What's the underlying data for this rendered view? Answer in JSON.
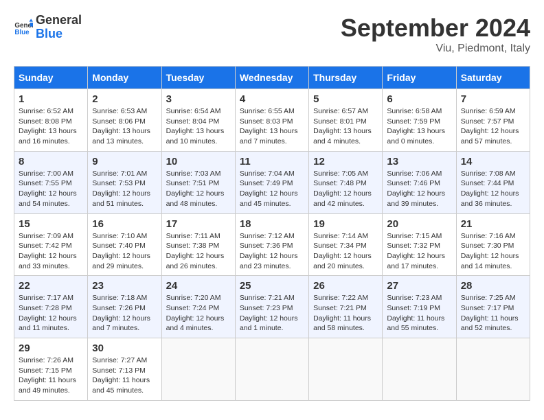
{
  "header": {
    "logo_line1": "General",
    "logo_line2": "Blue",
    "month": "September 2024",
    "location": "Viu, Piedmont, Italy"
  },
  "days_of_week": [
    "Sunday",
    "Monday",
    "Tuesday",
    "Wednesday",
    "Thursday",
    "Friday",
    "Saturday"
  ],
  "weeks": [
    [
      {
        "day": 1,
        "lines": [
          "Sunrise: 6:52 AM",
          "Sunset: 8:08 PM",
          "Daylight: 13 hours",
          "and 16 minutes."
        ]
      },
      {
        "day": 2,
        "lines": [
          "Sunrise: 6:53 AM",
          "Sunset: 8:06 PM",
          "Daylight: 13 hours",
          "and 13 minutes."
        ]
      },
      {
        "day": 3,
        "lines": [
          "Sunrise: 6:54 AM",
          "Sunset: 8:04 PM",
          "Daylight: 13 hours",
          "and 10 minutes."
        ]
      },
      {
        "day": 4,
        "lines": [
          "Sunrise: 6:55 AM",
          "Sunset: 8:03 PM",
          "Daylight: 13 hours",
          "and 7 minutes."
        ]
      },
      {
        "day": 5,
        "lines": [
          "Sunrise: 6:57 AM",
          "Sunset: 8:01 PM",
          "Daylight: 13 hours",
          "and 4 minutes."
        ]
      },
      {
        "day": 6,
        "lines": [
          "Sunrise: 6:58 AM",
          "Sunset: 7:59 PM",
          "Daylight: 13 hours",
          "and 0 minutes."
        ]
      },
      {
        "day": 7,
        "lines": [
          "Sunrise: 6:59 AM",
          "Sunset: 7:57 PM",
          "Daylight: 12 hours",
          "and 57 minutes."
        ]
      }
    ],
    [
      {
        "day": 8,
        "lines": [
          "Sunrise: 7:00 AM",
          "Sunset: 7:55 PM",
          "Daylight: 12 hours",
          "and 54 minutes."
        ]
      },
      {
        "day": 9,
        "lines": [
          "Sunrise: 7:01 AM",
          "Sunset: 7:53 PM",
          "Daylight: 12 hours",
          "and 51 minutes."
        ]
      },
      {
        "day": 10,
        "lines": [
          "Sunrise: 7:03 AM",
          "Sunset: 7:51 PM",
          "Daylight: 12 hours",
          "and 48 minutes."
        ]
      },
      {
        "day": 11,
        "lines": [
          "Sunrise: 7:04 AM",
          "Sunset: 7:49 PM",
          "Daylight: 12 hours",
          "and 45 minutes."
        ]
      },
      {
        "day": 12,
        "lines": [
          "Sunrise: 7:05 AM",
          "Sunset: 7:48 PM",
          "Daylight: 12 hours",
          "and 42 minutes."
        ]
      },
      {
        "day": 13,
        "lines": [
          "Sunrise: 7:06 AM",
          "Sunset: 7:46 PM",
          "Daylight: 12 hours",
          "and 39 minutes."
        ]
      },
      {
        "day": 14,
        "lines": [
          "Sunrise: 7:08 AM",
          "Sunset: 7:44 PM",
          "Daylight: 12 hours",
          "and 36 minutes."
        ]
      }
    ],
    [
      {
        "day": 15,
        "lines": [
          "Sunrise: 7:09 AM",
          "Sunset: 7:42 PM",
          "Daylight: 12 hours",
          "and 33 minutes."
        ]
      },
      {
        "day": 16,
        "lines": [
          "Sunrise: 7:10 AM",
          "Sunset: 7:40 PM",
          "Daylight: 12 hours",
          "and 29 minutes."
        ]
      },
      {
        "day": 17,
        "lines": [
          "Sunrise: 7:11 AM",
          "Sunset: 7:38 PM",
          "Daylight: 12 hours",
          "and 26 minutes."
        ]
      },
      {
        "day": 18,
        "lines": [
          "Sunrise: 7:12 AM",
          "Sunset: 7:36 PM",
          "Daylight: 12 hours",
          "and 23 minutes."
        ]
      },
      {
        "day": 19,
        "lines": [
          "Sunrise: 7:14 AM",
          "Sunset: 7:34 PM",
          "Daylight: 12 hours",
          "and 20 minutes."
        ]
      },
      {
        "day": 20,
        "lines": [
          "Sunrise: 7:15 AM",
          "Sunset: 7:32 PM",
          "Daylight: 12 hours",
          "and 17 minutes."
        ]
      },
      {
        "day": 21,
        "lines": [
          "Sunrise: 7:16 AM",
          "Sunset: 7:30 PM",
          "Daylight: 12 hours",
          "and 14 minutes."
        ]
      }
    ],
    [
      {
        "day": 22,
        "lines": [
          "Sunrise: 7:17 AM",
          "Sunset: 7:28 PM",
          "Daylight: 12 hours",
          "and 11 minutes."
        ]
      },
      {
        "day": 23,
        "lines": [
          "Sunrise: 7:18 AM",
          "Sunset: 7:26 PM",
          "Daylight: 12 hours",
          "and 7 minutes."
        ]
      },
      {
        "day": 24,
        "lines": [
          "Sunrise: 7:20 AM",
          "Sunset: 7:24 PM",
          "Daylight: 12 hours",
          "and 4 minutes."
        ]
      },
      {
        "day": 25,
        "lines": [
          "Sunrise: 7:21 AM",
          "Sunset: 7:23 PM",
          "Daylight: 12 hours",
          "and 1 minute."
        ]
      },
      {
        "day": 26,
        "lines": [
          "Sunrise: 7:22 AM",
          "Sunset: 7:21 PM",
          "Daylight: 11 hours",
          "and 58 minutes."
        ]
      },
      {
        "day": 27,
        "lines": [
          "Sunrise: 7:23 AM",
          "Sunset: 7:19 PM",
          "Daylight: 11 hours",
          "and 55 minutes."
        ]
      },
      {
        "day": 28,
        "lines": [
          "Sunrise: 7:25 AM",
          "Sunset: 7:17 PM",
          "Daylight: 11 hours",
          "and 52 minutes."
        ]
      }
    ],
    [
      {
        "day": 29,
        "lines": [
          "Sunrise: 7:26 AM",
          "Sunset: 7:15 PM",
          "Daylight: 11 hours",
          "and 49 minutes."
        ]
      },
      {
        "day": 30,
        "lines": [
          "Sunrise: 7:27 AM",
          "Sunset: 7:13 PM",
          "Daylight: 11 hours",
          "and 45 minutes."
        ]
      },
      null,
      null,
      null,
      null,
      null
    ]
  ]
}
